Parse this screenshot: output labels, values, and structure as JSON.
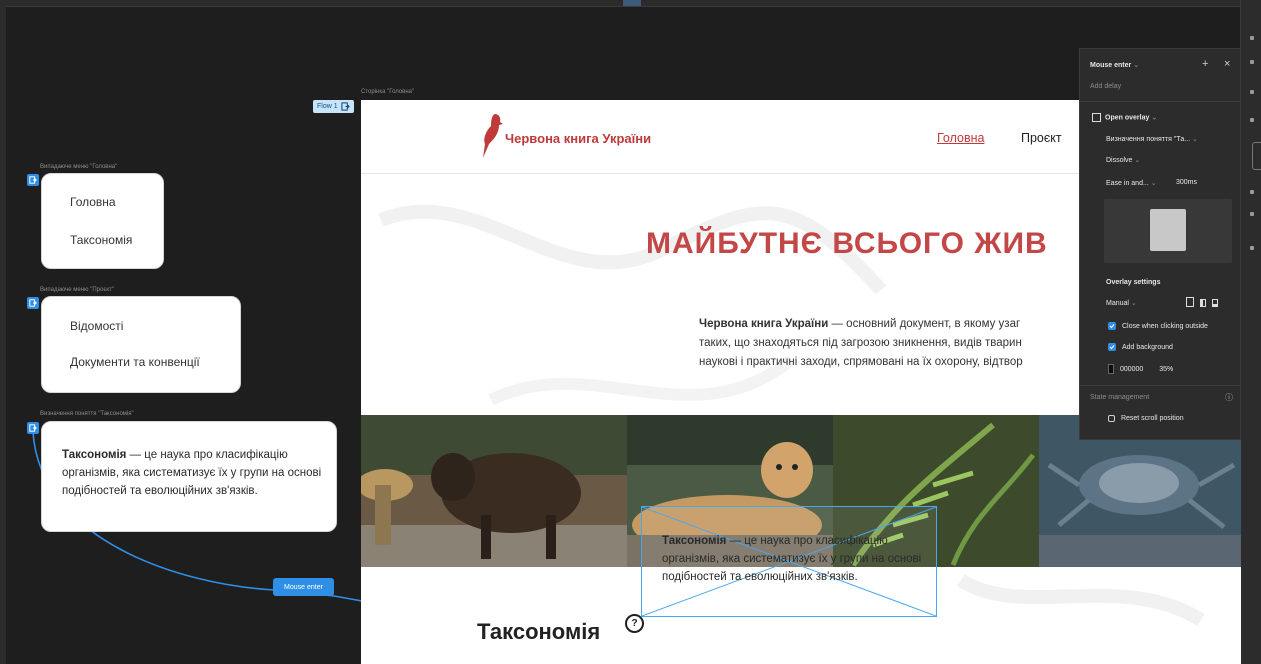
{
  "canvas": {
    "flow_badge": "Flow 1",
    "frame_main_label": "Сторінка \"Головна\"",
    "frame_menu_home_label": "Випадаюче меню \"Головна\"",
    "frame_menu_project_label": "Випадаюче меню \"Проєкт\"",
    "frame_definition_label": "Визначення поняття \"Таксономія\""
  },
  "menu_home": {
    "items": [
      "Головна",
      "Таксономія"
    ]
  },
  "menu_project": {
    "items": [
      "Відомості",
      "Документи та конвенції"
    ]
  },
  "definition": {
    "term": "Таксономія",
    "text": " — це наука про класифікацію організмів, яка систематизує їх у групи на основі подібностей та еволюційних зв'язків."
  },
  "page": {
    "logo_text": "Червона книга України",
    "nav": [
      "Головна",
      "Проєкт"
    ],
    "hero_title": "МАЙБУТНЄ ВСЬОГО ЖИВ",
    "hero_lines": [
      {
        "bold": "Червона книга України",
        "rest": " — основний документ, в якому узаг"
      },
      {
        "bold": "",
        "rest": "таких, що знаходяться під загрозою зникнення, видів тварин"
      },
      {
        "bold": "",
        "rest": "наукові і практичні заходи, спрямовані на їх охорону, відтвор"
      }
    ],
    "section_title": "Таксономія"
  },
  "connection": {
    "trigger_label": "Mouse enter",
    "target_glyph": "?"
  },
  "interaction_panel": {
    "trigger": "Mouse enter",
    "add_delay": "Add delay",
    "action": "Open overlay",
    "destination": "Визначення поняття \"Та...",
    "animation": "Dissolve",
    "easing": "Ease in and...",
    "duration": "300ms",
    "overlay_settings_title": "Overlay settings",
    "position": "Manual",
    "close_outside_label": "Close when clicking outside",
    "add_background_label": "Add background",
    "background_color": "000000",
    "background_opacity": "35%",
    "state_management_title": "State management",
    "reset_scroll_label": "Reset scroll position"
  },
  "colors": {
    "accent_red": "#c44748",
    "figma_blue": "#2f8fe6",
    "canvas_bg": "#1e1e1e",
    "panel_bg": "#2c2c2c"
  },
  "icons": [
    "prototype-flow-icon",
    "bird-logo-icon",
    "plus-icon",
    "close-icon",
    "chevron-down-icon",
    "checkbox-icon",
    "info-icon"
  ]
}
